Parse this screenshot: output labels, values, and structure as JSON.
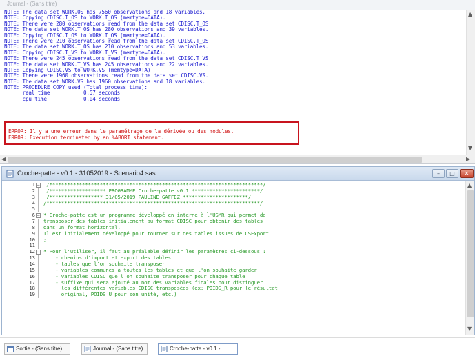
{
  "log_window": {
    "title": "Journal - (Sans titre)",
    "lines": [
      "NOTE: The data set WORK.OS has 7560 observations and 18 variables.",
      "NOTE: Copying CDISC.T_OS to WORK.T_OS (memtype=DATA).",
      "NOTE: There were 280 observations read from the data set CDISC.T_OS.",
      "NOTE: The data set WORK.T_OS has 280 observations and 39 variables.",
      "NOTE: Copying CDISC.T_OS to WORK.T_OS (memtype=DATA).",
      "NOTE: There were 210 observations read from the data set CDISC.T_OS.",
      "NOTE: The data set WORK.T_OS has 210 observations and 53 variables.",
      "NOTE: Copying CDISC.T_VS to WORK.T_VS (memtype=DATA).",
      "NOTE: There were 245 observations read from the data set CDISC.T_VS.",
      "NOTE: The data set WORK.T_VS has 245 observations and 22 variables.",
      "NOTE: Copying CDISC.VS to WORK.VS (memtype=DATA).",
      "NOTE: There were 1960 observations read from the data set CDISC.VS.",
      "NOTE: The data set WORK.VS has 1960 observations and 18 variables.",
      "NOTE: PROCEDURE COPY used (Total process time):",
      "      real time           0.57 seconds",
      "      cpu time            0.04 seconds"
    ],
    "errors": [
      "ERROR: Il y a une erreur dans le paramétrage de la dérivée ou des modules.",
      "ERROR: Execution terminated by an %ABORT statement."
    ]
  },
  "program_window": {
    "title": "Croche-patte - v0.1 - 31052019 - Scenario4.sas",
    "lines": [
      {
        "n": "1",
        "text": " /************************************************************************/"
      },
      {
        "n": "2",
        "text": " /******************* PROGRAMME Croche-patte v0.1 ***********************/"
      },
      {
        "n": "3",
        "text": " /****************** 31/05/2019 PAULINE GAFFEZ **********************/"
      },
      {
        "n": "4",
        "text": "/************************************************************************/"
      },
      {
        "n": "5",
        "text": ""
      },
      {
        "n": "6",
        "text": "* Croche-patte est un programme développé en interne à l'USMR qui permet de"
      },
      {
        "n": "7",
        "text": "transposer des tables initialement au format CDISC pour obtenir des tables"
      },
      {
        "n": "8",
        "text": "dans un format horizontal."
      },
      {
        "n": "9",
        "text": "Il est initialement développé pour tourner sur des tables issues de CSExport."
      },
      {
        "n": "10",
        "text": ";"
      },
      {
        "n": "11",
        "text": ""
      },
      {
        "n": "12",
        "text": "* Pour l'utiliser, il faut au préalable définir les paramètres ci-dessous :"
      },
      {
        "n": "13",
        "text": "    - chemins d'import et export des tables"
      },
      {
        "n": "14",
        "text": "    - tables que l'on souhaite transposer"
      },
      {
        "n": "15",
        "text": "    - variables communes à toutes les tables et que l'on souhaite garder"
      },
      {
        "n": "16",
        "text": "    - variables CDISC que l'on souhaite transposer pour chaque table"
      },
      {
        "n": "17",
        "text": "    - suffixe qui sera ajouté au nom des variables finales pour distinguer"
      },
      {
        "n": "18",
        "text": "      les différentes variables CDISC transposées (ex: POIDS_R pour le résultat"
      },
      {
        "n": "19",
        "text": "      original, POIDS_U pour son unité, etc.)"
      }
    ]
  },
  "taskbar": {
    "items": [
      {
        "label": "Sortie - (Sans titre)"
      },
      {
        "label": "Journal - (Sans titre)"
      },
      {
        "label": "Croche-patte - v0.1 - ..."
      }
    ]
  },
  "colors": {
    "note_text": "#1c1cd0",
    "error_text": "#d01818",
    "error_box": "#c8141e",
    "code_comment": "#2a9a2a",
    "line_number": "#3c3c3c"
  }
}
